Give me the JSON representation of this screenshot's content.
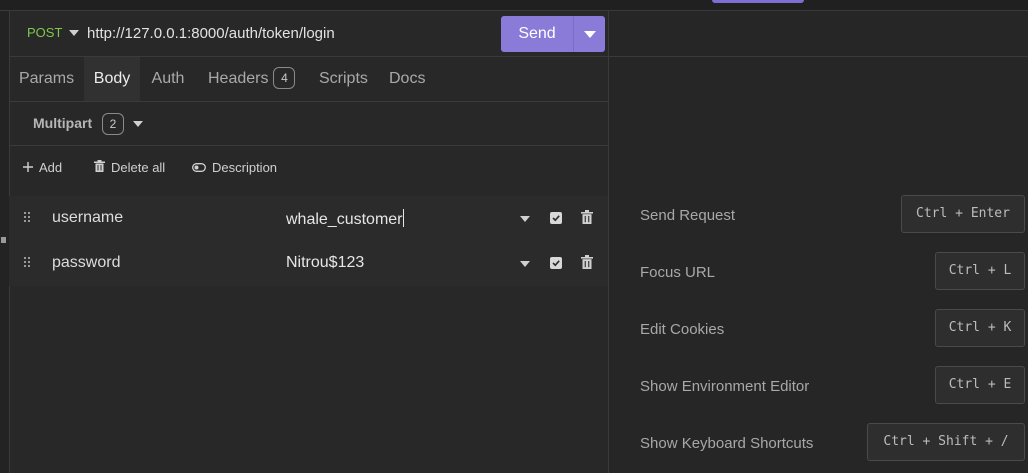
{
  "request": {
    "method": "POST",
    "url": "http://127.0.0.1:8000/auth/token/login",
    "send_label": "Send"
  },
  "tabs": [
    {
      "label": "Params"
    },
    {
      "label": "Body",
      "active": true
    },
    {
      "label": "Auth"
    },
    {
      "label": "Headers",
      "badge": "4"
    },
    {
      "label": "Scripts"
    },
    {
      "label": "Docs"
    }
  ],
  "body": {
    "type_label": "Multipart",
    "count": "2"
  },
  "actions": {
    "add": "Add",
    "delete_all": "Delete all",
    "description": "Description"
  },
  "params": [
    {
      "name": "username",
      "value": "whale_customer",
      "enabled": true
    },
    {
      "name": "password",
      "value": "Nitrou$123",
      "enabled": true
    }
  ],
  "shortcuts": [
    {
      "label": "Send Request",
      "keys": "Ctrl + Enter"
    },
    {
      "label": "Focus URL",
      "keys": "Ctrl + L"
    },
    {
      "label": "Edit Cookies",
      "keys": "Ctrl + K"
    },
    {
      "label": "Show Environment Editor",
      "keys": "Ctrl + E"
    },
    {
      "label": "Show Keyboard Shortcuts",
      "keys": "Ctrl + Shift + /"
    }
  ],
  "colors": {
    "accent": "#8a7bd8",
    "method_post": "#7ec84f",
    "background": "#282828"
  }
}
